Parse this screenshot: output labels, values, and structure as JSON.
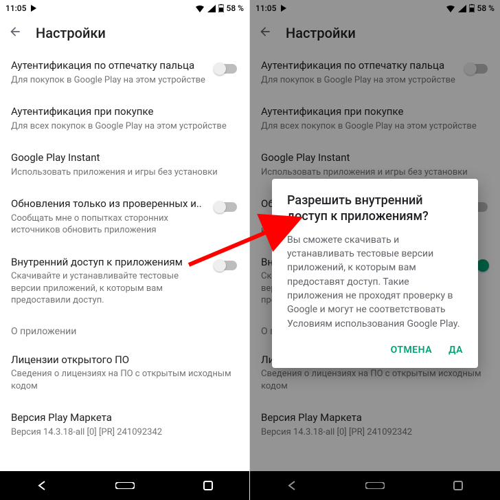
{
  "status": {
    "time": "11:05",
    "battery": "58 %"
  },
  "appbar": {
    "title": "Настройки"
  },
  "items": {
    "fingerprint": {
      "title": "Аутентификация по отпечатку пальца",
      "sub": "Для покупок в Google Play на этом устройстве"
    },
    "purchase": {
      "title": "Аутентификация при покупке",
      "sub": "Для всех покупок в Google Play на этом устройстве"
    },
    "instant": {
      "title": "Google Play Instant",
      "sub": "Использовать приложения и игры без установки"
    },
    "updates": {
      "title": "Обновления только из проверенных и..",
      "sub": "Сообщать мне о попытках сторонних источников обновить приложения"
    },
    "internal": {
      "title": "Внутренний доступ к приложениям",
      "sub": "Скачивайте и устанавливайте тестовые версии приложений, к которым вам предоставили доступ."
    },
    "about_section": "О приложении",
    "licenses": {
      "title": "Лицензии открытого ПО",
      "sub": "Сведения о лицензиях на ПО с открытым исходным кодом"
    },
    "version": {
      "title": "Версия Play Маркета",
      "sub": "Версия 14.3.18-all [0] [PR] 241092342"
    }
  },
  "dialog": {
    "title": "Разрешить внутренний доступ к приложениям?",
    "body": "Вы сможете скачивать и устанавливать тестовые версии приложений, к которым вам предоставят доступ. Такие приложения не проходят проверку в Google и могут не соответствовать Условиям использования Google Play.",
    "cancel": "ОТМЕНА",
    "ok": "ДА"
  }
}
